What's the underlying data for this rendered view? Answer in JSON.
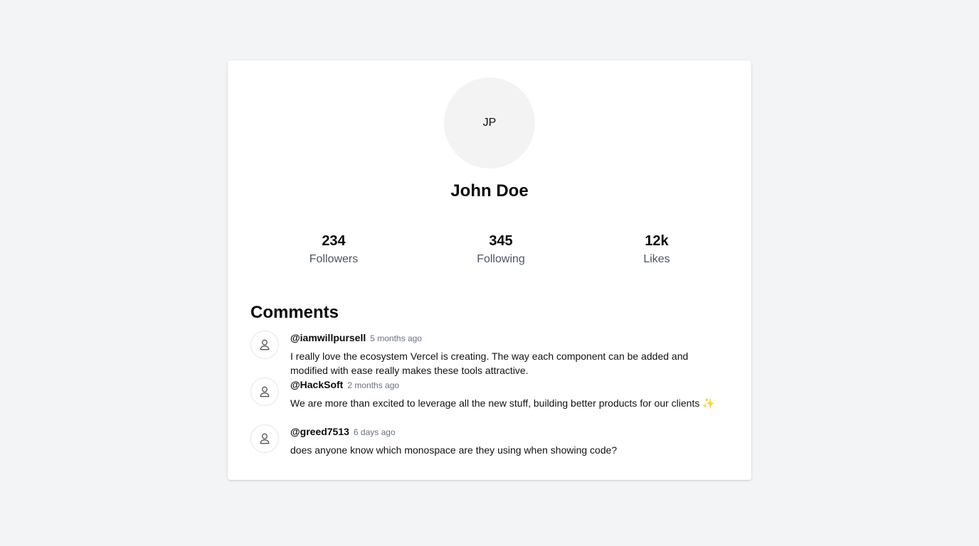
{
  "profile": {
    "initials": "JP",
    "name": "John Doe"
  },
  "stats": [
    {
      "value": "234",
      "label": "Followers"
    },
    {
      "value": "345",
      "label": "Following"
    },
    {
      "value": "12k",
      "label": "Likes"
    }
  ],
  "comments": {
    "title": "Comments",
    "items": [
      {
        "user": "@iamwillpursell",
        "time": "5 months ago",
        "text": "I really love the ecosystem Vercel is creating. The way each component can be added and modified with ease really makes these tools attractive.",
        "avatar_icon": "user-icon"
      },
      {
        "user": "@HackSoft",
        "time": "2 months ago",
        "text": "We are more than excited to leverage all the new stuff, building better products for our clients ✨",
        "avatar_icon": "user-icon"
      },
      {
        "user": "@greed7513",
        "time": "6 days ago",
        "text": "does anyone know which monospace are they using when showing code?",
        "avatar_icon": "user-icon"
      }
    ]
  }
}
